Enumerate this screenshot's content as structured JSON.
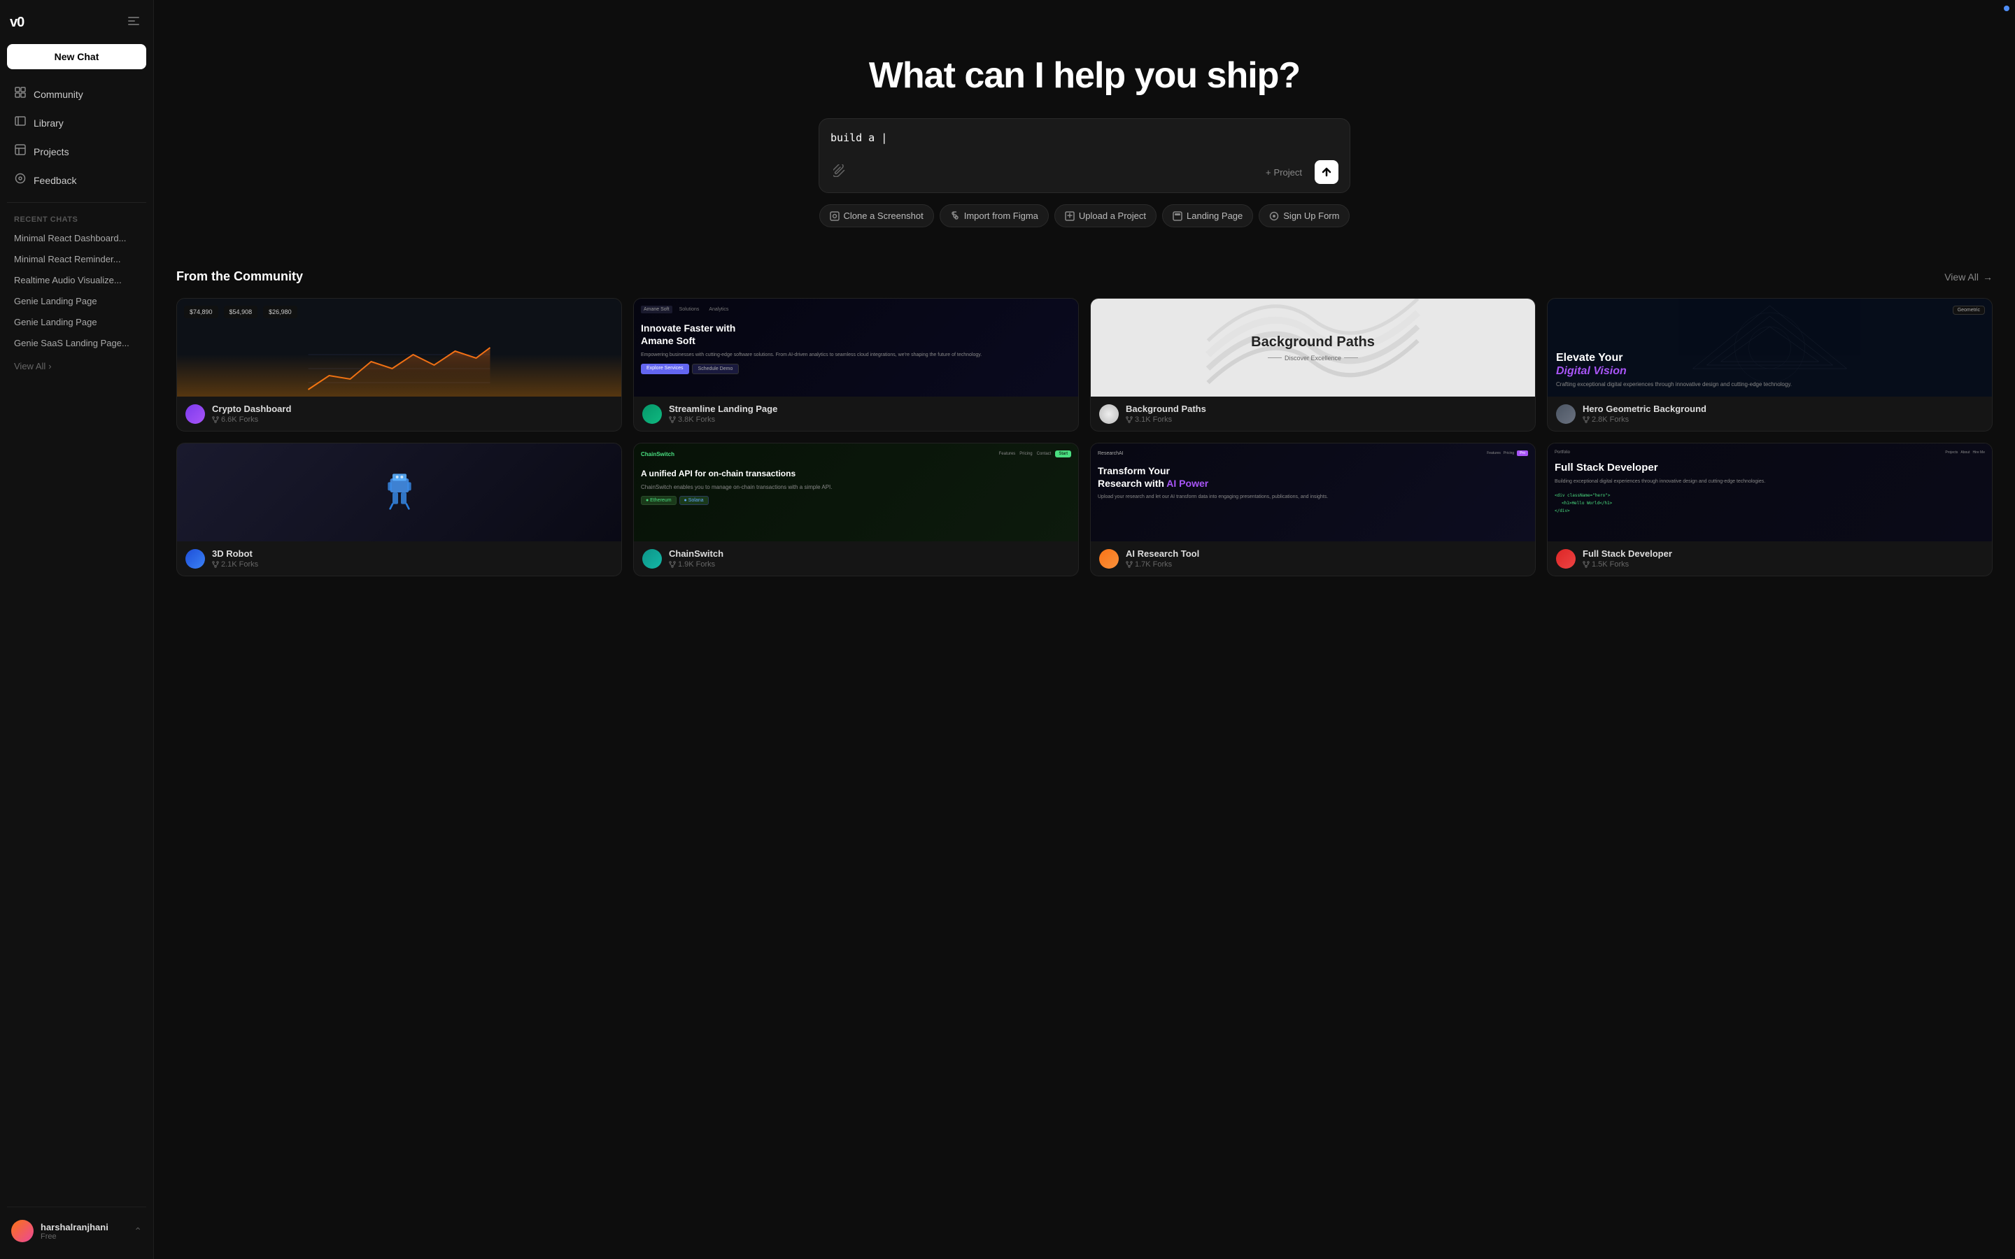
{
  "app": {
    "logo": "v0",
    "dot_color": "#4f8ef7"
  },
  "sidebar": {
    "new_chat_label": "New Chat",
    "nav_items": [
      {
        "id": "community",
        "label": "Community",
        "icon": "⊞"
      },
      {
        "id": "library",
        "label": "Library",
        "icon": "📖"
      },
      {
        "id": "projects",
        "label": "Projects",
        "icon": "◫"
      },
      {
        "id": "feedback",
        "label": "Feedback",
        "icon": "◎"
      }
    ],
    "recent_label": "Recent Chats",
    "recent_items": [
      {
        "id": 1,
        "label": "Minimal React Dashboard..."
      },
      {
        "id": 2,
        "label": "Minimal React Reminder..."
      },
      {
        "id": 3,
        "label": "Realtime Audio Visualize..."
      },
      {
        "id": 4,
        "label": "Genie Landing Page"
      },
      {
        "id": 5,
        "label": "Genie Landing Page"
      },
      {
        "id": 6,
        "label": "Genie SaaS Landing Page..."
      }
    ],
    "view_all_label": "View All",
    "user": {
      "name": "harshalranjhani",
      "plan": "Free"
    }
  },
  "hero": {
    "title": "What can I help you ship?",
    "input_value": "build a",
    "input_placeholder": "",
    "project_label": "+ Project",
    "quick_actions": [
      {
        "id": "screenshot",
        "label": "Clone a Screenshot",
        "icon": "📷"
      },
      {
        "id": "figma",
        "label": "Import from Figma",
        "icon": "◈"
      },
      {
        "id": "upload",
        "label": "Upload a Project",
        "icon": "📄"
      },
      {
        "id": "landing",
        "label": "Landing Page",
        "icon": "◻"
      },
      {
        "id": "signup",
        "label": "Sign Up Form",
        "icon": "○"
      }
    ]
  },
  "community": {
    "title": "From the Community",
    "view_all_label": "View All",
    "cards_row1": [
      {
        "id": "crypto",
        "title": "Crypto Dashboard",
        "forks": "6.6K Forks",
        "avatar_class": "av-purple",
        "bg_type": "crypto"
      },
      {
        "id": "streamline",
        "title": "Streamline Landing Page",
        "forks": "3.8K Forks",
        "avatar_class": "av-green",
        "bg_type": "streamline",
        "overlay_title": "Innovate Faster with Amane Soft",
        "overlay_sub": "Empowering businesses with cutting-edge software solutions. From AI-driven analytics to seamless cloud integrations, we're shaping the future of technology."
      },
      {
        "id": "bgpaths",
        "title": "Background Paths",
        "forks": "3.1K Forks",
        "avatar_class": "av-white",
        "bg_type": "bgpaths",
        "overlay_title": "Background Paths",
        "overlay_sub": "Discover Excellence ⟶"
      },
      {
        "id": "herogeo",
        "title": "Hero Geometric Background",
        "forks": "2.8K Forks",
        "avatar_class": "av-gray",
        "bg_type": "herogeo",
        "overlay_title": "Elevate Your",
        "overlay_accent": "Digital Vision",
        "overlay_sub": "Crafting exceptional digital experiences through innovative design and cutting-edge technology."
      }
    ],
    "cards_row2": [
      {
        "id": "robot",
        "title": "3D Robot",
        "forks": "2.1K Forks",
        "avatar_class": "av-blue",
        "bg_type": "robot"
      },
      {
        "id": "chain",
        "title": "ChainSwitch",
        "forks": "1.9K Forks",
        "avatar_class": "av-teal",
        "bg_type": "chain",
        "overlay_title": "A unified API for on-chain transactions",
        "overlay_sub": "ChainSwitch"
      },
      {
        "id": "research",
        "title": "AI Research Tool",
        "forks": "1.7K Forks",
        "avatar_class": "av-orange",
        "bg_type": "research",
        "overlay_title": "Transform Your Research with AI Power",
        "overlay_sub": "ResearchAI"
      },
      {
        "id": "fullstack",
        "title": "Full Stack Developer",
        "forks": "1.5K Forks",
        "avatar_class": "av-red",
        "bg_type": "fullstack",
        "overlay_title": "Full Stack Developer",
        "overlay_sub": "Building exceptional digital experiences through innovative design and cutting-edge technologies."
      }
    ]
  }
}
